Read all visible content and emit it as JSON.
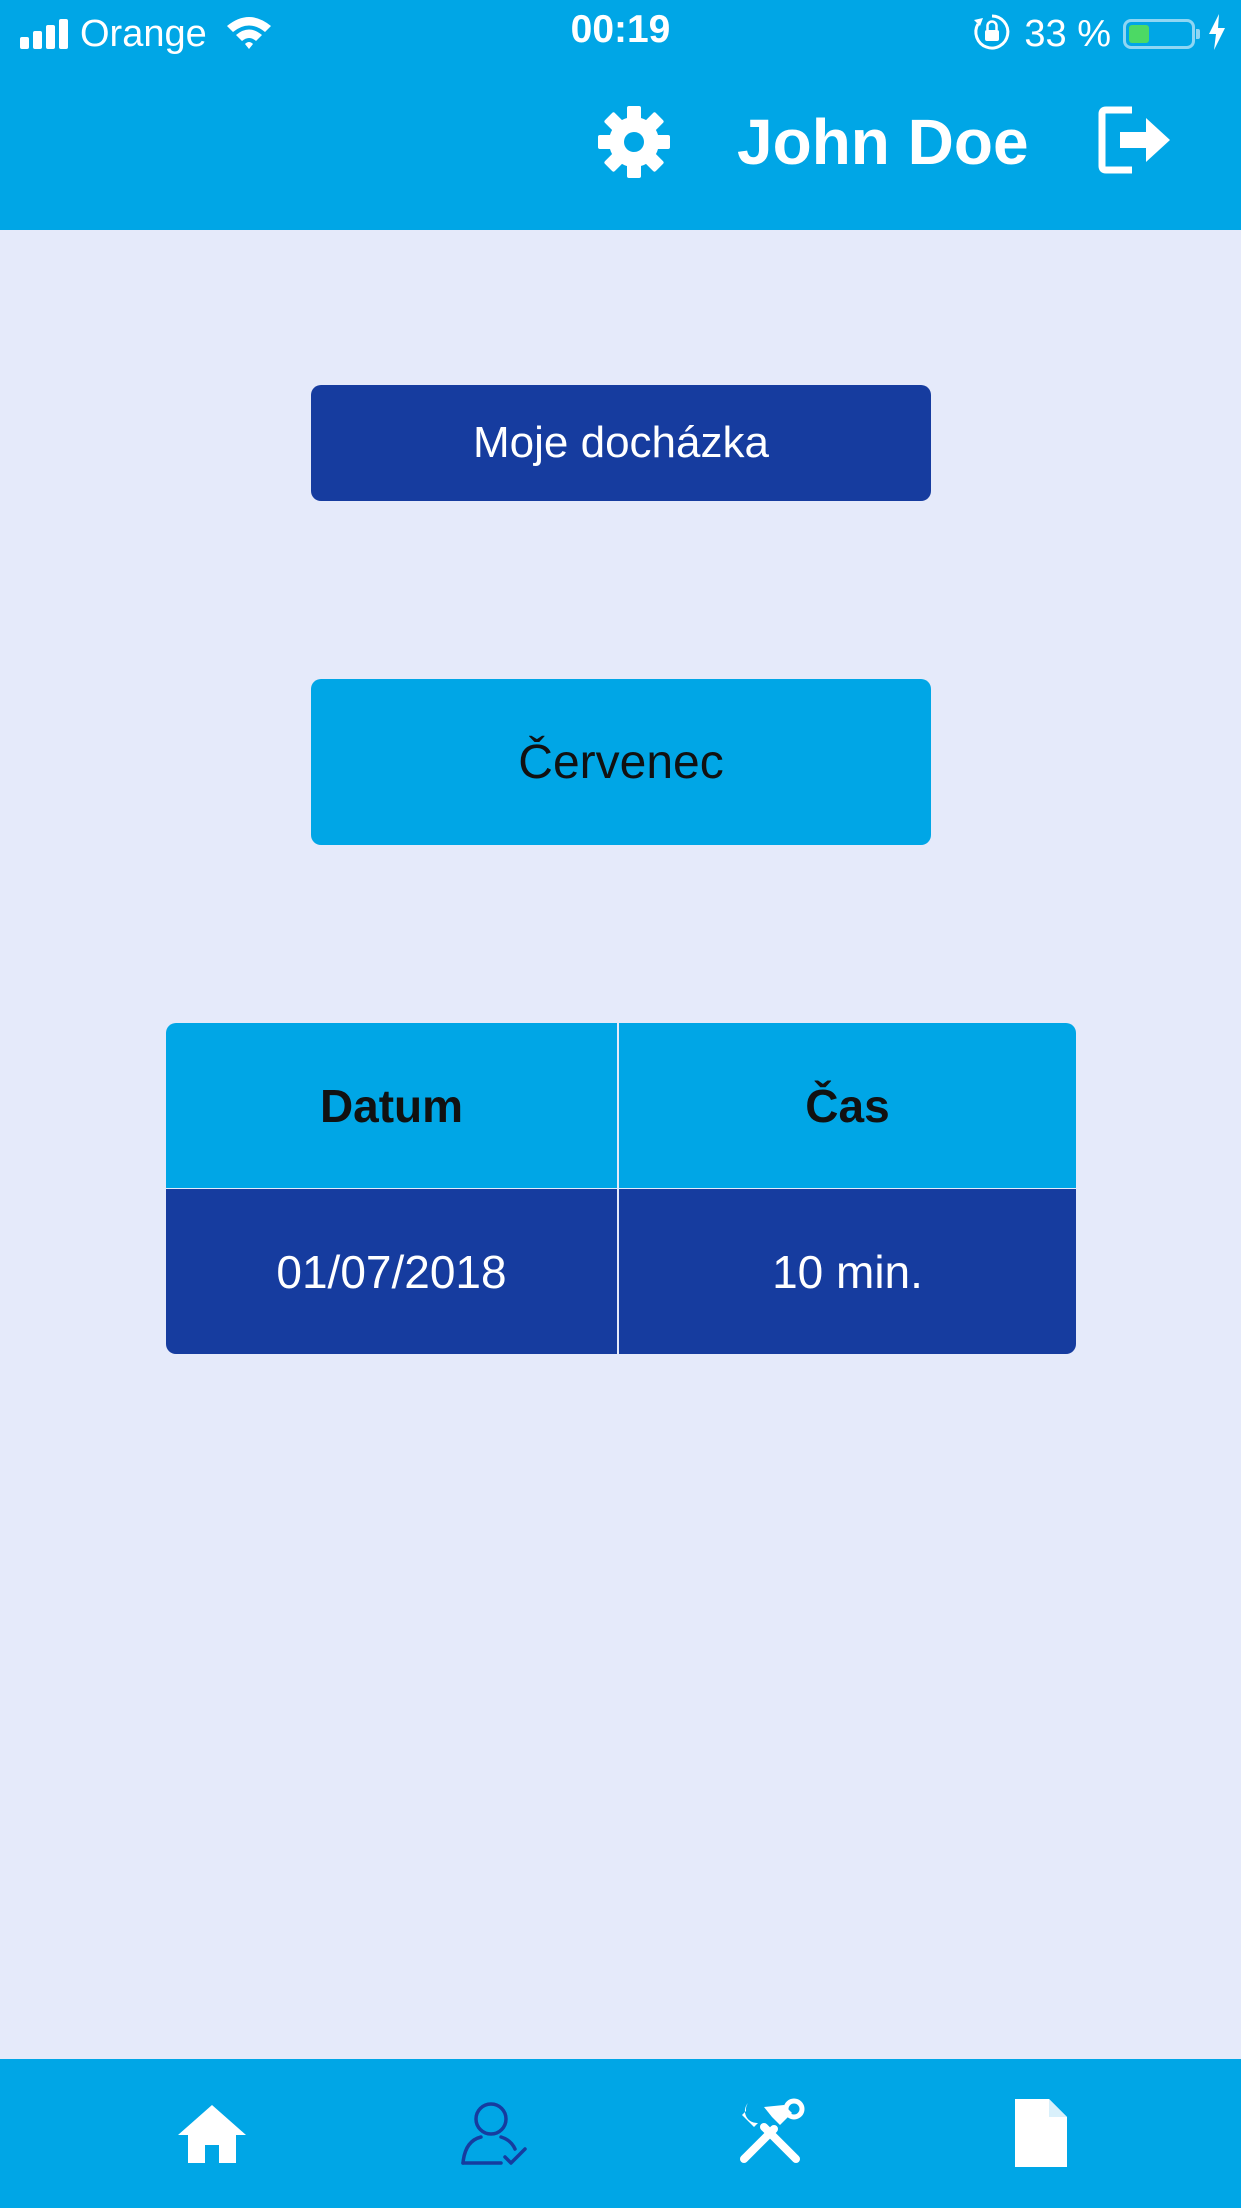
{
  "status_bar": {
    "carrier": "Orange",
    "time": "00:19",
    "battery": "33 %",
    "battery_level": 0.33
  },
  "header": {
    "user_name": "John Doe",
    "icons": [
      "gear-icon",
      "logout-icon"
    ]
  },
  "main": {
    "attendance_button": "Moje docházka",
    "month_button": "Červenec",
    "table": {
      "columns": [
        "Datum",
        "Čas"
      ],
      "rows": [
        [
          "01/07/2018",
          "10 min."
        ]
      ]
    }
  },
  "tab_bar": {
    "items": [
      "home-icon",
      "user-check-icon",
      "tools-icon",
      "document-icon"
    ]
  },
  "colors": {
    "primary": "#00a6e6",
    "dark_blue": "#163c9f",
    "background": "#e5eafa"
  }
}
